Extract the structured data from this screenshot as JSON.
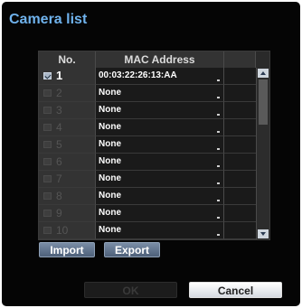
{
  "dialog": {
    "title": "Camera list"
  },
  "table": {
    "headers": {
      "no": "No.",
      "mac": "MAC Address"
    },
    "rows": [
      {
        "num": "1",
        "checked": true,
        "mac": "00:03:22:26:13:AA"
      },
      {
        "num": "2",
        "checked": false,
        "mac": "None"
      },
      {
        "num": "3",
        "checked": false,
        "mac": "None"
      },
      {
        "num": "4",
        "checked": false,
        "mac": "None"
      },
      {
        "num": "5",
        "checked": false,
        "mac": "None"
      },
      {
        "num": "6",
        "checked": false,
        "mac": "None"
      },
      {
        "num": "7",
        "checked": false,
        "mac": "None"
      },
      {
        "num": "8",
        "checked": false,
        "mac": "None"
      },
      {
        "num": "9",
        "checked": false,
        "mac": "None"
      },
      {
        "num": "10",
        "checked": false,
        "mac": "None"
      }
    ]
  },
  "buttons": {
    "import": "Import",
    "export": "Export",
    "ok": "OK",
    "cancel": "Cancel"
  },
  "colors": {
    "title": "#6fb2ec",
    "background": "#050505"
  }
}
